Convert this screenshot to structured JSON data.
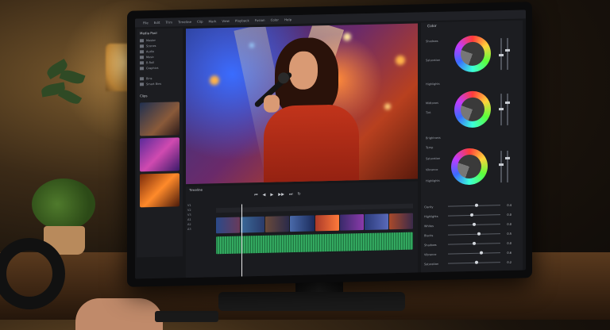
{
  "menubar": [
    "File",
    "Edit",
    "Trim",
    "Timeline",
    "Clip",
    "Mark",
    "View",
    "Playback",
    "Fusion",
    "Color",
    "Help"
  ],
  "media_panel": {
    "title": "Media Pool",
    "folders": [
      "Master",
      "Scenes",
      "Audio",
      "Music",
      "B-Roll",
      "Graphics"
    ],
    "bins": [
      "Bins",
      "Smart Bins"
    ],
    "clips_title": "Clips"
  },
  "color_panel": {
    "title": "Color",
    "wheels": [
      {
        "label": "Shadows",
        "sub": "Saturation"
      },
      {
        "label": "Midtones",
        "sub": "Tint"
      },
      {
        "label": "Highlights",
        "sub": "Offset"
      }
    ],
    "wheel_extra_labels": [
      "Highlights",
      "Brightness",
      "Temp",
      "Saturation",
      "Vibrance"
    ],
    "adjustments": [
      {
        "label": "Clarity",
        "value": "0.4",
        "level": 0.55
      },
      {
        "label": "Highlights",
        "value": "0.0",
        "level": 0.45
      },
      {
        "label": "Whites",
        "value": "0.0",
        "level": 0.5
      },
      {
        "label": "Blacks",
        "value": "0.5",
        "level": 0.6
      },
      {
        "label": "Shadows",
        "value": "0.0",
        "level": 0.5
      },
      {
        "label": "Vibrance",
        "value": "0.6",
        "level": 0.65
      },
      {
        "label": "Saturation",
        "value": "0.2",
        "level": 0.55
      }
    ]
  },
  "timeline": {
    "title": "Timeline",
    "tracks": [
      "V1",
      "V2",
      "V3",
      "A1",
      "A2",
      "A3"
    ]
  },
  "colors": {
    "accent_audio": "#2fa35c",
    "panel_bg": "#1c1d21",
    "shirt": "#c2341b"
  }
}
